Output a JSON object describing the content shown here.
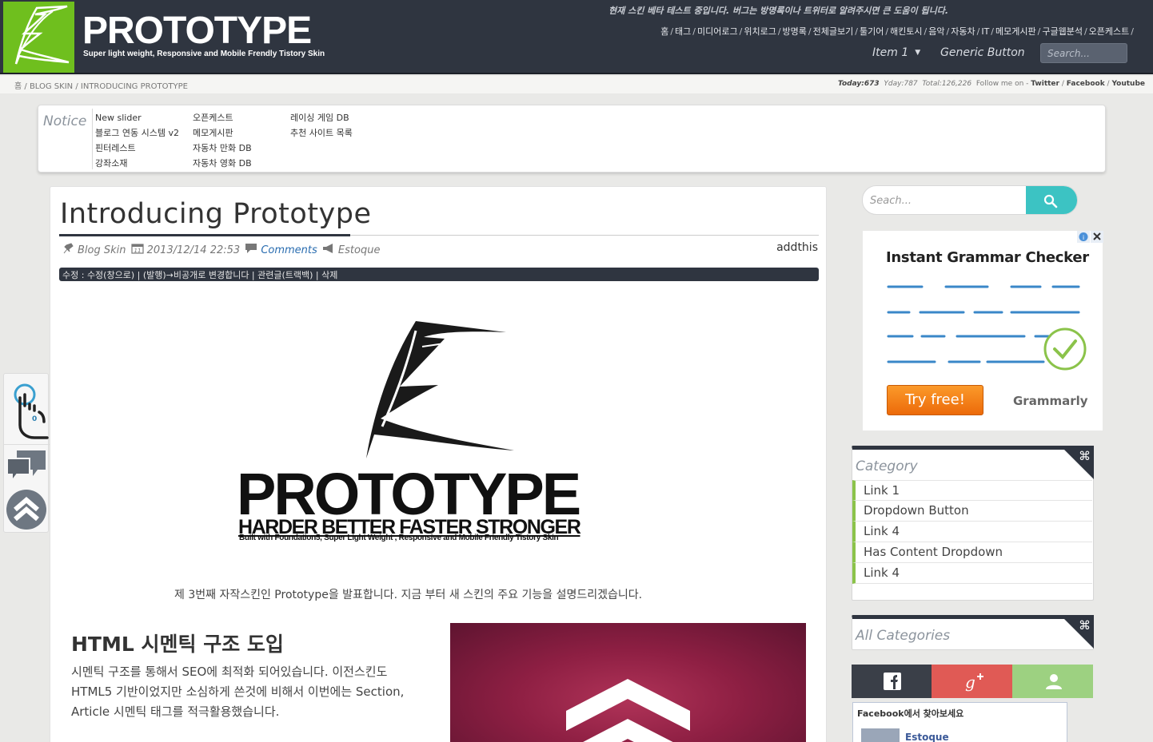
{
  "header": {
    "brand_title": "PROTOTYPE",
    "brand_tagline": "Super light weight, Responsive and Mobile Frendly Tistory Skin",
    "notice_line": "현재 스킨 베타 테스트 중입니다. 버그는 방명록이나 트위터로 알려주시면 큰 도움이 됩니다.",
    "top_links": [
      "홈",
      "태그",
      "미디어로그",
      "위치로그",
      "방명록",
      "전체글보기",
      "툴기어",
      "해킨토시",
      "음악",
      "자동차",
      "IT",
      "메모게시판",
      "구글웹분석",
      "오픈케스트"
    ],
    "nav": {
      "item1": "Item 1",
      "generic_button": "Generic Button"
    },
    "search_placeholder": "Search..."
  },
  "breadcrumb": {
    "home": "홈",
    "category": "BLOG SKIN",
    "current": "INTRODUCING PROTOTYPE"
  },
  "stats": {
    "today_label": "Today:",
    "today": "673",
    "yday_label": "Yday:",
    "yday": "787",
    "total_label": "Total:",
    "total": "126,226",
    "follow_label": "Follow me on -",
    "twitter": "Twitter",
    "facebook": "Facebook",
    "youtube": "Youtube"
  },
  "notice": {
    "label": "Notice",
    "col1": [
      "New slider",
      "블로그 연동 시스템 v2",
      "핀터레스트",
      "강좌소재"
    ],
    "col2": [
      "오픈케스트",
      "메모게시판",
      "자동차 만화 DB",
      "자동차 영화 DB"
    ],
    "col3": [
      "레이싱 게임 DB",
      "추천 사이트 목록"
    ]
  },
  "post": {
    "title": "Introducing Prototype",
    "category": "Blog Skin",
    "date": "2013/12/14 22:53",
    "comments": "Comments",
    "author": "Estoque",
    "addthis": "addthis",
    "admin_bar": "수정 : 수정(창으로) | (발행)→비공개로 변경합니다 | 관련글(트랙백) | 삭제",
    "hero_word": "PROTOTYPE",
    "hero_slogan": "HARDER BETTER FASTER STRONGER",
    "hero_built": "Built with Foundation5, Super Light Weight , Responsive and Mobile Friendly Tistory Skin",
    "intro": "제 3번째 자작스킨인 Prototype을 발표합니다. 지금 부터 새 스킨의 주요 기능을 설명드리겠습니다.",
    "section_heading": "HTML 시멘틱 구조 도입",
    "section_body": "시멘틱 구조를 통해서 SEO에 최적화 되어있습니다. 이전스킨도 HTML5 기반이었지만 소심하게 쓴것에 비해서 이번에는 Section, Article 시멘틱 태그를 적극활용했습니다."
  },
  "float_bar": {
    "like_count": "0"
  },
  "sidebar": {
    "search_placeholder": "Seach...",
    "ad": {
      "title": "Instant Grammar Checker",
      "button": "Try free!",
      "brand": "Grammarly"
    },
    "category_widget": {
      "title": "Category",
      "items": [
        "Link 1",
        "Dropdown Button",
        "Link 4",
        "Has Content Dropdown",
        "Link 4"
      ]
    },
    "all_categories_title": "All Categories",
    "facebook_box": {
      "title": "Facebook에서 찾아보세요",
      "name": "Estoque"
    }
  },
  "colors": {
    "header_bg": "#2f3540",
    "logo_green": "#6fbf1e",
    "accent_teal": "#3cc3c3",
    "category_accent": "#8bc34a",
    "link_blue": "#2a6db0"
  }
}
